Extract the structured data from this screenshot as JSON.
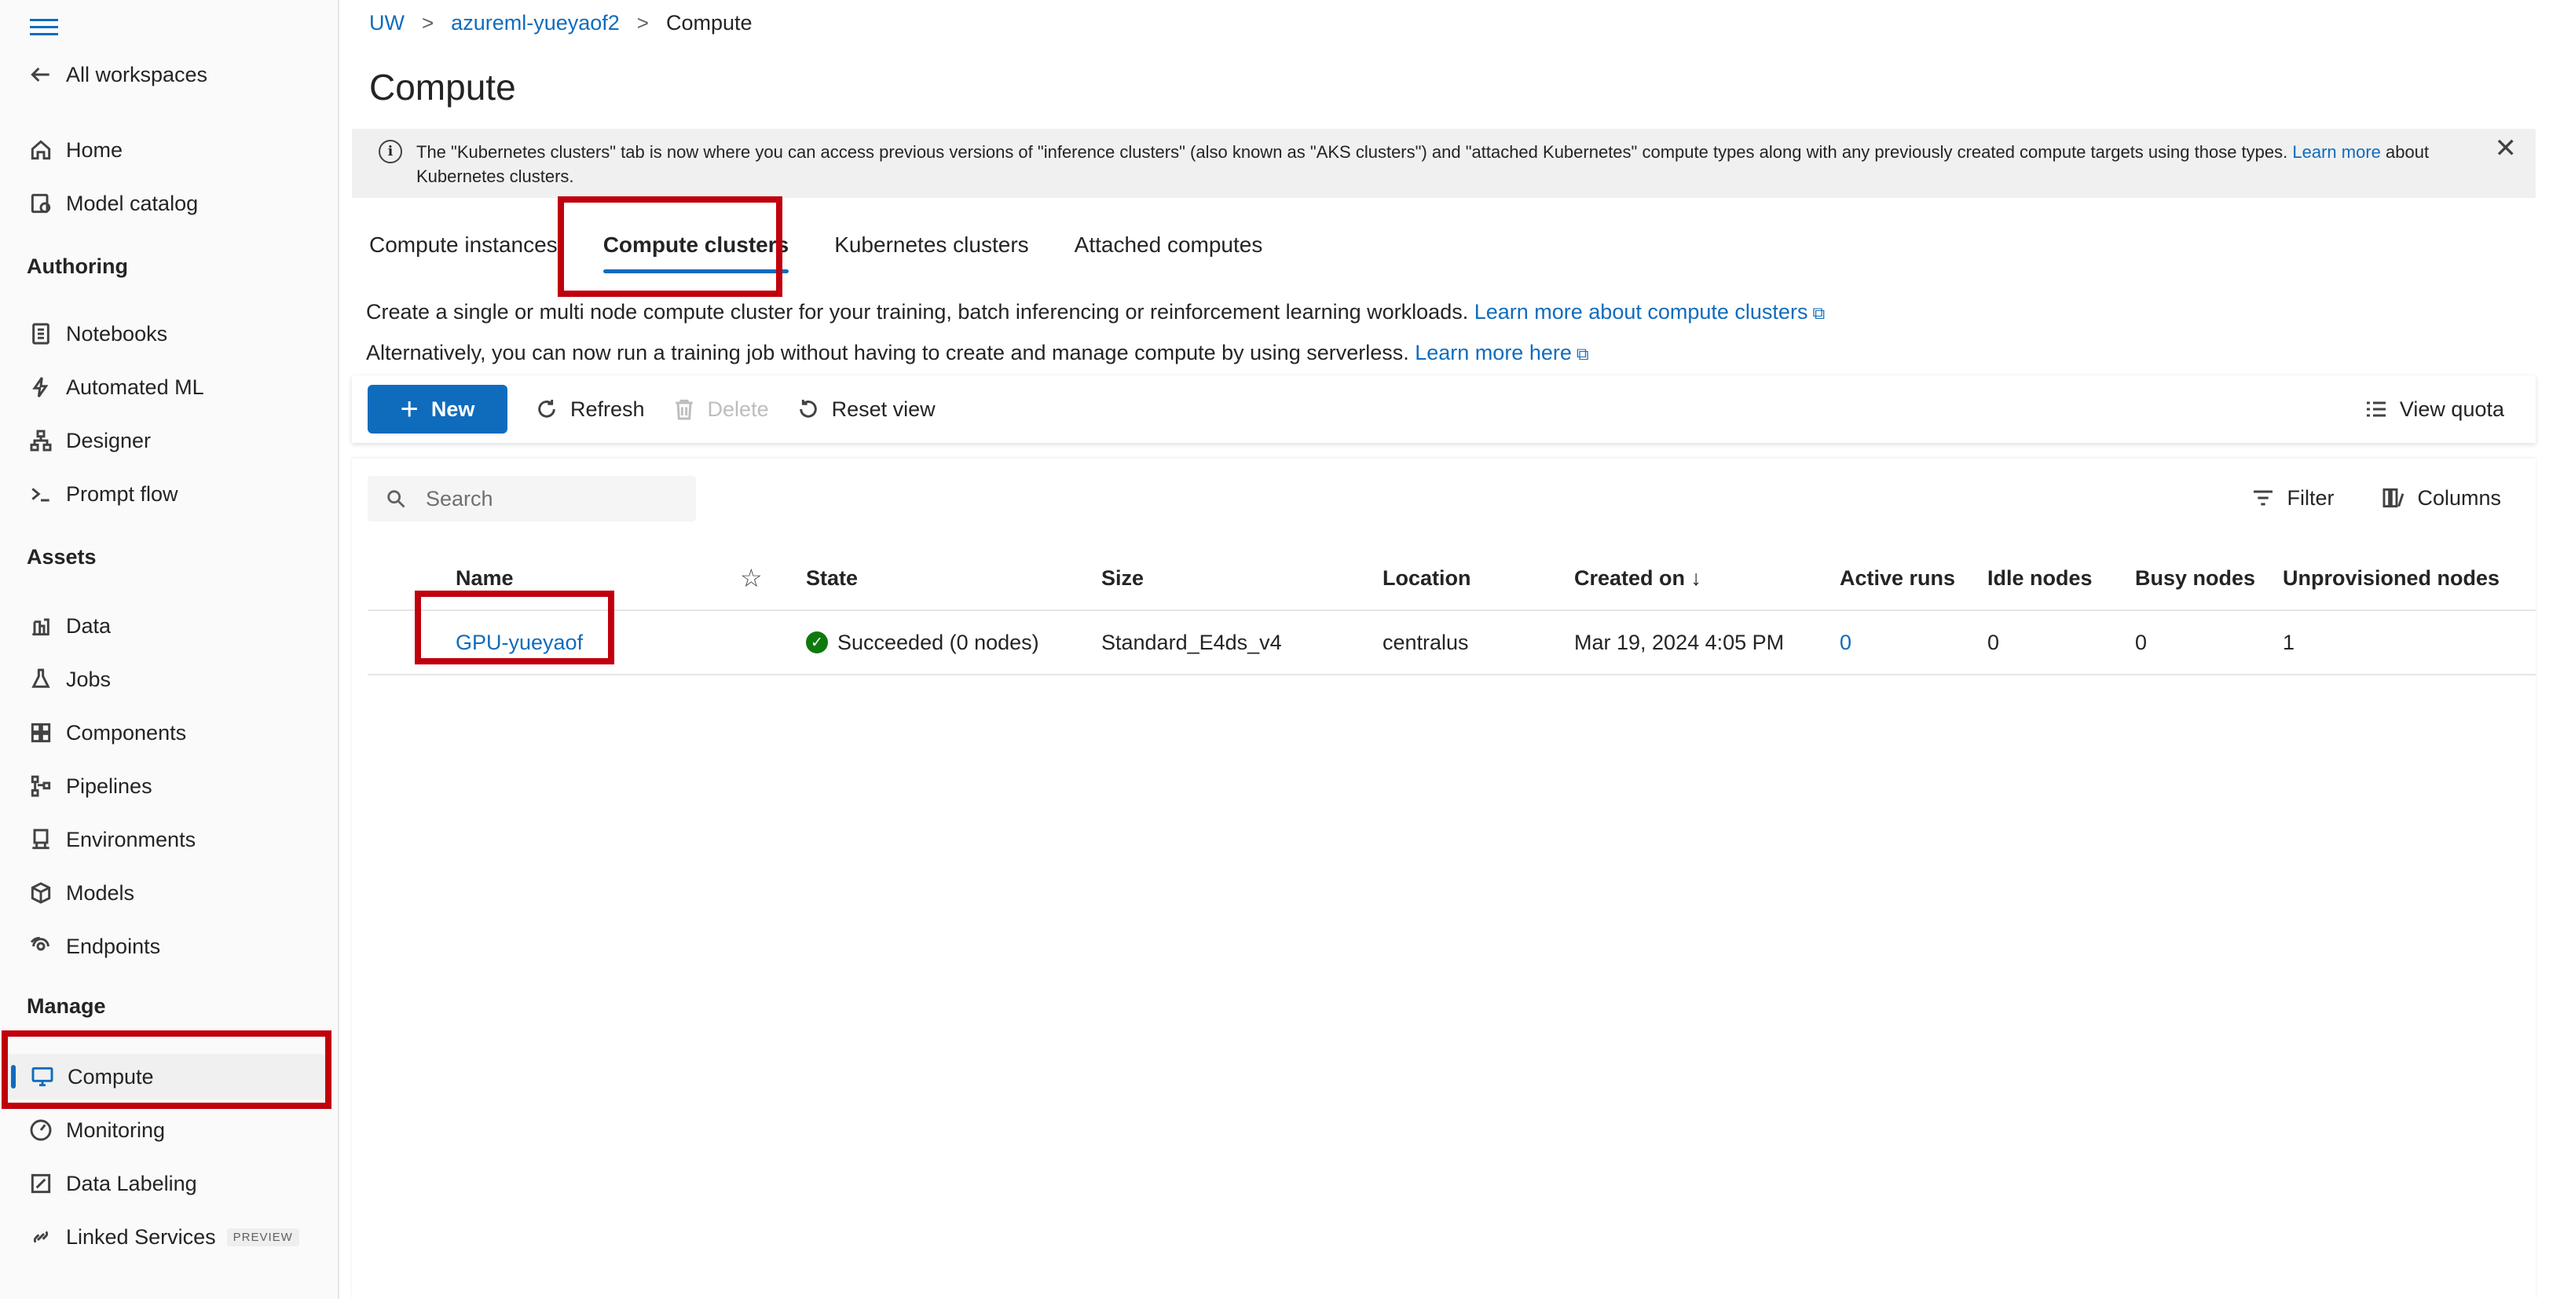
{
  "sidebar": {
    "back_label": "All workspaces",
    "items_top": [
      {
        "label": "Home",
        "icon": "home-icon"
      },
      {
        "label": "Model catalog",
        "icon": "model-catalog-icon"
      }
    ],
    "authoring_heading": "Authoring",
    "authoring_items": [
      {
        "label": "Notebooks",
        "icon": "notebook-icon"
      },
      {
        "label": "Automated ML",
        "icon": "automated-ml-icon"
      },
      {
        "label": "Designer",
        "icon": "designer-icon"
      },
      {
        "label": "Prompt flow",
        "icon": "prompt-flow-icon"
      }
    ],
    "assets_heading": "Assets",
    "assets_items": [
      {
        "label": "Data",
        "icon": "data-icon"
      },
      {
        "label": "Jobs",
        "icon": "jobs-icon"
      },
      {
        "label": "Components",
        "icon": "components-icon"
      },
      {
        "label": "Pipelines",
        "icon": "pipelines-icon"
      },
      {
        "label": "Environments",
        "icon": "environments-icon"
      },
      {
        "label": "Models",
        "icon": "models-icon"
      },
      {
        "label": "Endpoints",
        "icon": "endpoints-icon"
      }
    ],
    "manage_heading": "Manage",
    "manage_items": [
      {
        "label": "Compute",
        "icon": "compute-icon",
        "active": true
      },
      {
        "label": "Monitoring",
        "icon": "monitoring-icon"
      },
      {
        "label": "Data Labeling",
        "icon": "data-labeling-icon"
      },
      {
        "label": "Linked Services",
        "icon": "linked-services-icon",
        "badge": "PREVIEW"
      }
    ]
  },
  "breadcrumb": [
    "UW",
    "azureml-yueyaof2",
    "Compute"
  ],
  "page_title": "Compute",
  "banner": {
    "text": "The \"Kubernetes clusters\" tab is now where you can access previous versions of \"inference clusters\" (also known as \"AKS clusters\") and \"attached Kubernetes\" compute types along with any previously created compute targets using those types. ",
    "link": "Learn more",
    "text_after": " about Kubernetes clusters."
  },
  "tabs": [
    "Compute instances",
    "Compute clusters",
    "Kubernetes clusters",
    "Attached computes"
  ],
  "selected_tab": "Compute clusters",
  "description": {
    "line1": "Create a single or multi node compute cluster for your training, batch inferencing or reinforcement learning workloads. ",
    "line1_link": "Learn more about compute clusters",
    "line2": "Alternatively, you can now run a training job without having to create and manage compute by using serverless. ",
    "line2_link": "Learn more here"
  },
  "toolbar": {
    "new": "New",
    "refresh": "Refresh",
    "delete": "Delete",
    "reset_view": "Reset view",
    "view_quota": "View quota"
  },
  "grid": {
    "search_placeholder": "Search",
    "filter": "Filter",
    "columns_btn": "Columns",
    "headers": {
      "name": "Name",
      "state": "State",
      "size": "Size",
      "location": "Location",
      "created_on": "Created on ↓",
      "active_runs": "Active runs",
      "idle_nodes": "Idle nodes",
      "busy_nodes": "Busy nodes",
      "unprovisioned_nodes": "Unprovisioned nodes"
    },
    "rows": [
      {
        "name": "GPU-yueyaof",
        "state": "Succeeded (0 nodes)",
        "size": "Standard_E4ds_v4",
        "location": "centralus",
        "created_on": "Mar 19, 2024 4:05 PM",
        "active_runs": "0",
        "idle_nodes": "0",
        "busy_nodes": "0",
        "unprovisioned_nodes": "1"
      }
    ]
  },
  "colors": {
    "accent": "#0f6cbd",
    "highlight_box": "#c0000c",
    "success": "#0e7a0d"
  }
}
